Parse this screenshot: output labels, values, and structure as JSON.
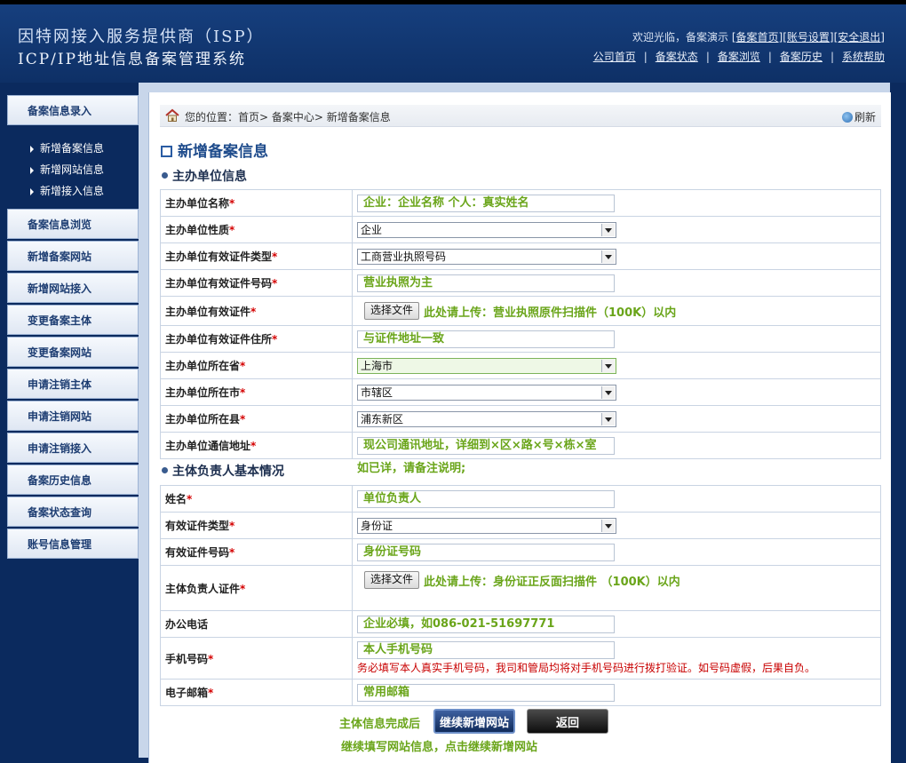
{
  "header": {
    "title_line1": "因特网接入服务提供商（ISP）",
    "title_line2": "ICP/IP地址信息备案管理系统",
    "welcome": "欢迎光临，备案演示",
    "user_links": [
      "[备案首页]",
      "[账号设置]",
      "[安全退出]"
    ],
    "nav_links": [
      "公司首页",
      "备案状态",
      "备案浏览",
      "备案历史",
      "系统帮助"
    ],
    "nav_separator": "|"
  },
  "sidebar": {
    "top_item": "备案信息录入",
    "sub_items": [
      "新增备案信息",
      "新增网站信息",
      "新增接入信息"
    ],
    "items": [
      "备案信息浏览",
      "新增备案网站",
      "新增网站接入",
      "变更备案主体",
      "变更备案网站",
      "申请注销主体",
      "申请注销网站",
      "申请注销接入",
      "备案历史信息",
      "备案状态查询",
      "账号信息管理"
    ]
  },
  "breadcrumb": {
    "text": "您的位置：首页> 备案中心> 新增备案信息",
    "refresh": "刷新"
  },
  "page_title": "新增备案信息",
  "section1": {
    "title": "主办单位信息",
    "rows": [
      {
        "label": "主办单位名称",
        "type": "text",
        "value": "企业：企业名称  个人：真实姓名"
      },
      {
        "label": "主办单位性质",
        "type": "select",
        "value": "企业"
      },
      {
        "label": "主办单位有效证件类型",
        "type": "select",
        "value": "工商营业执照号码"
      },
      {
        "label": "主办单位有效证件号码",
        "type": "text",
        "value": "营业执照为主"
      },
      {
        "label": "主办单位有效证件",
        "type": "file",
        "button": "选择文件",
        "hint": "此处请上传：营业执照原件扫描件（100K）以内"
      },
      {
        "label": "主办单位有效证件住所",
        "type": "text",
        "value": "与证件地址一致"
      },
      {
        "label": "主办单位所在省",
        "type": "select",
        "value": "上海市",
        "highlight": true
      },
      {
        "label": "主办单位所在市",
        "type": "select",
        "value": "市辖区"
      },
      {
        "label": "主办单位所在县",
        "type": "select",
        "value": "浦东新区"
      },
      {
        "label": "主办单位通信地址",
        "type": "text",
        "value": "现公司通讯地址，详细到×区×路×号×栋×室"
      }
    ],
    "address_note": "如已详，请备注说明;"
  },
  "section2": {
    "title": "主体负责人基本情况",
    "rows": [
      {
        "label": "姓名",
        "required": true,
        "type": "text",
        "value": "单位负责人"
      },
      {
        "label": "有效证件类型",
        "required": true,
        "type": "select",
        "value": "身份证"
      },
      {
        "label": "有效证件号码",
        "required": true,
        "type": "text",
        "value": "身份证号码"
      },
      {
        "label": "主体负责人证件",
        "required": true,
        "type": "file",
        "button": "选择文件",
        "hint": "此处请上传：身份证正反面扫描件 （100K）以内"
      },
      {
        "label": "办公电话",
        "required": false,
        "type": "text",
        "value": "企业必填，如086-021-51697771"
      },
      {
        "label": "手机号码",
        "required": true,
        "type": "text",
        "value": "本人手机号码",
        "note": "务必填写本人真实手机号码，我司和管局均将对手机号码进行拨打验证。如号码虚假，后果自负。"
      },
      {
        "label": "电子邮箱",
        "required": true,
        "type": "text",
        "value": "常用邮箱"
      }
    ]
  },
  "footer": {
    "done_note": "主体信息完成后",
    "continue_btn": "继续新增网站",
    "back_btn": "返回",
    "bottom_note": "继续填写网站信息，点击继续新增网站"
  },
  "required_mark": "*"
}
